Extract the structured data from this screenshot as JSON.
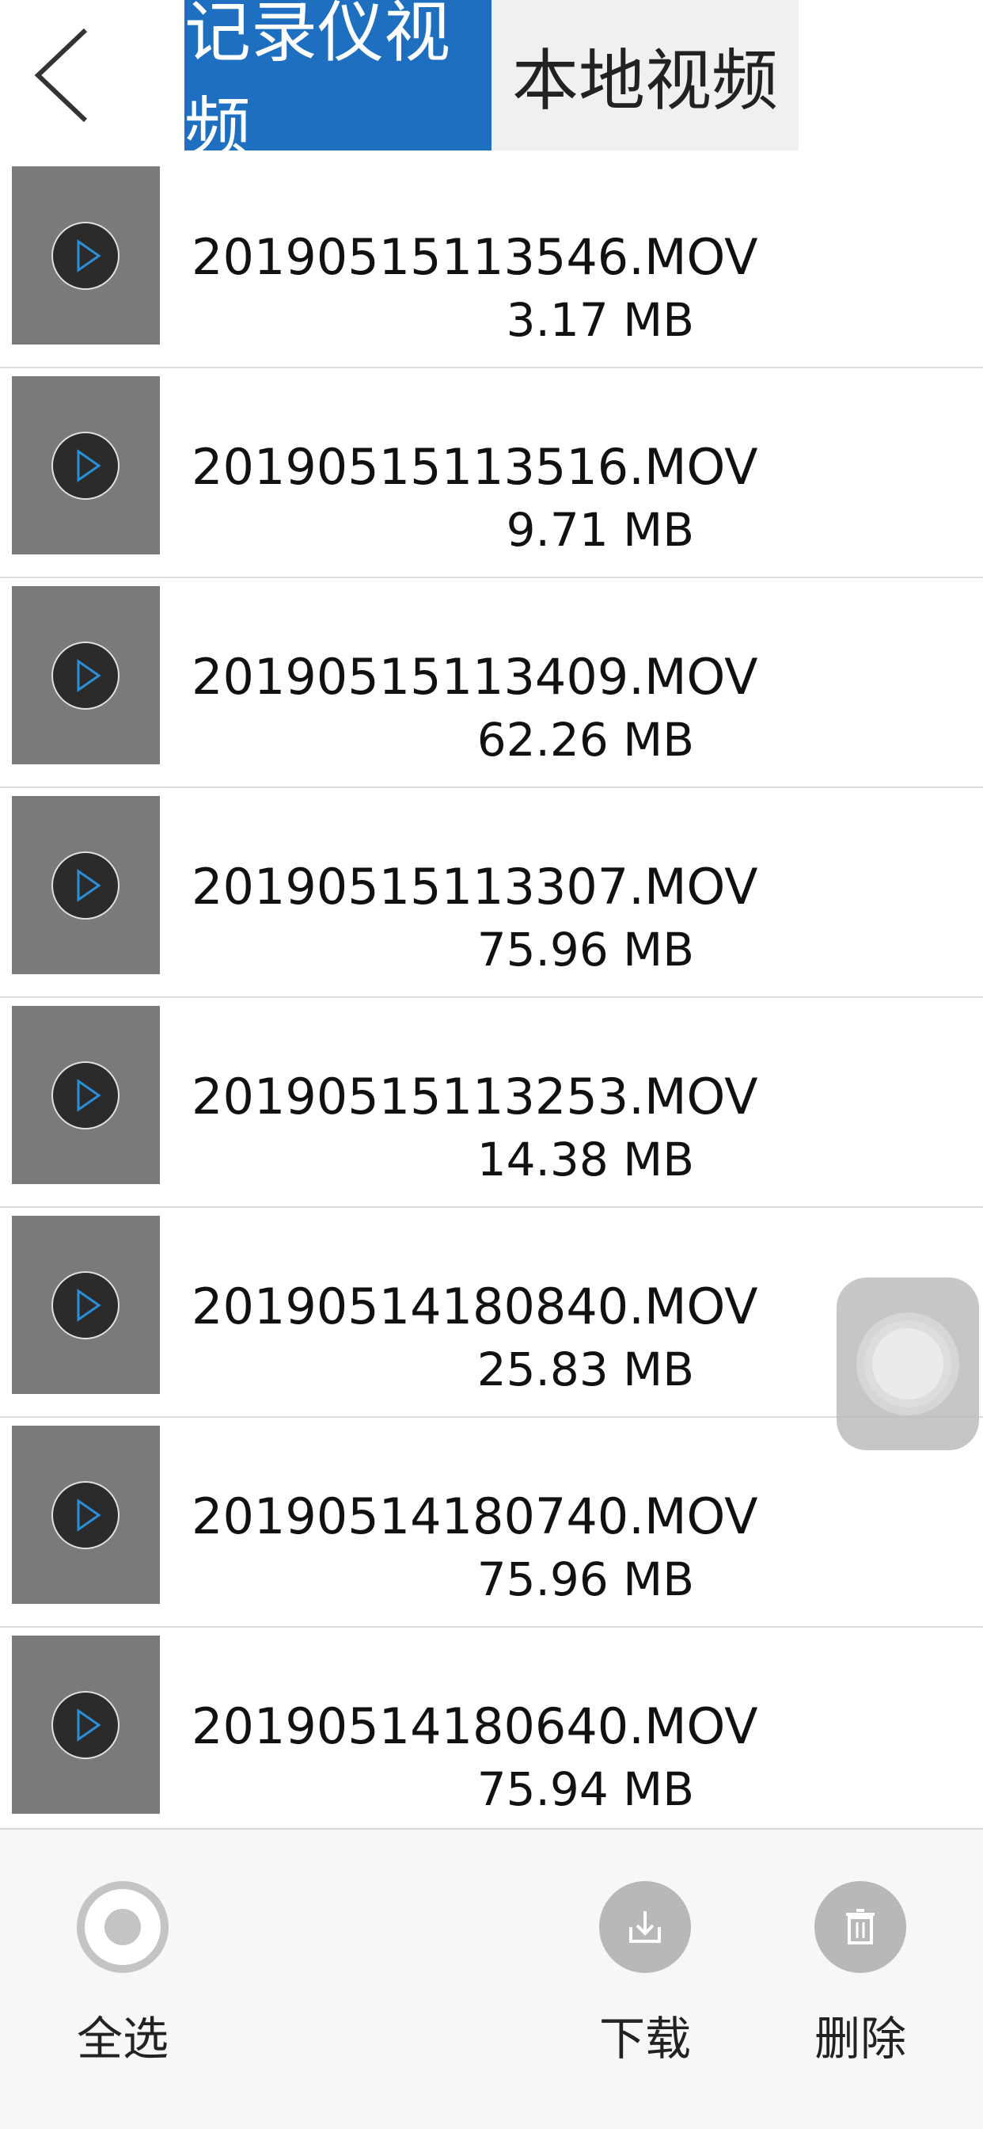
{
  "header": {
    "back_icon": "chevron-left-icon",
    "tabs": [
      {
        "label": "记录仪视频",
        "active": true
      },
      {
        "label": "本地视频",
        "active": false
      }
    ]
  },
  "videos": [
    {
      "name": "20190515113546.MOV",
      "size": "3.17 MB"
    },
    {
      "name": "20190515113516.MOV",
      "size": "9.71 MB"
    },
    {
      "name": "20190515113409.MOV",
      "size": "62.26 MB"
    },
    {
      "name": "20190515113307.MOV",
      "size": "75.96 MB"
    },
    {
      "name": "20190515113253.MOV",
      "size": "14.38 MB"
    },
    {
      "name": "20190514180840.MOV",
      "size": "25.83 MB"
    },
    {
      "name": "20190514180740.MOV",
      "size": "75.96 MB"
    },
    {
      "name": "20190514180640.MOV",
      "size": "75.94 MB"
    }
  ],
  "toolbar": {
    "select_all_label": "全选",
    "download_label": "下载",
    "delete_label": "删除"
  },
  "colors": {
    "accent": "#1e6fc0",
    "thumb_bg": "#7a7a7a",
    "play_icon": "#2a8fd8"
  }
}
